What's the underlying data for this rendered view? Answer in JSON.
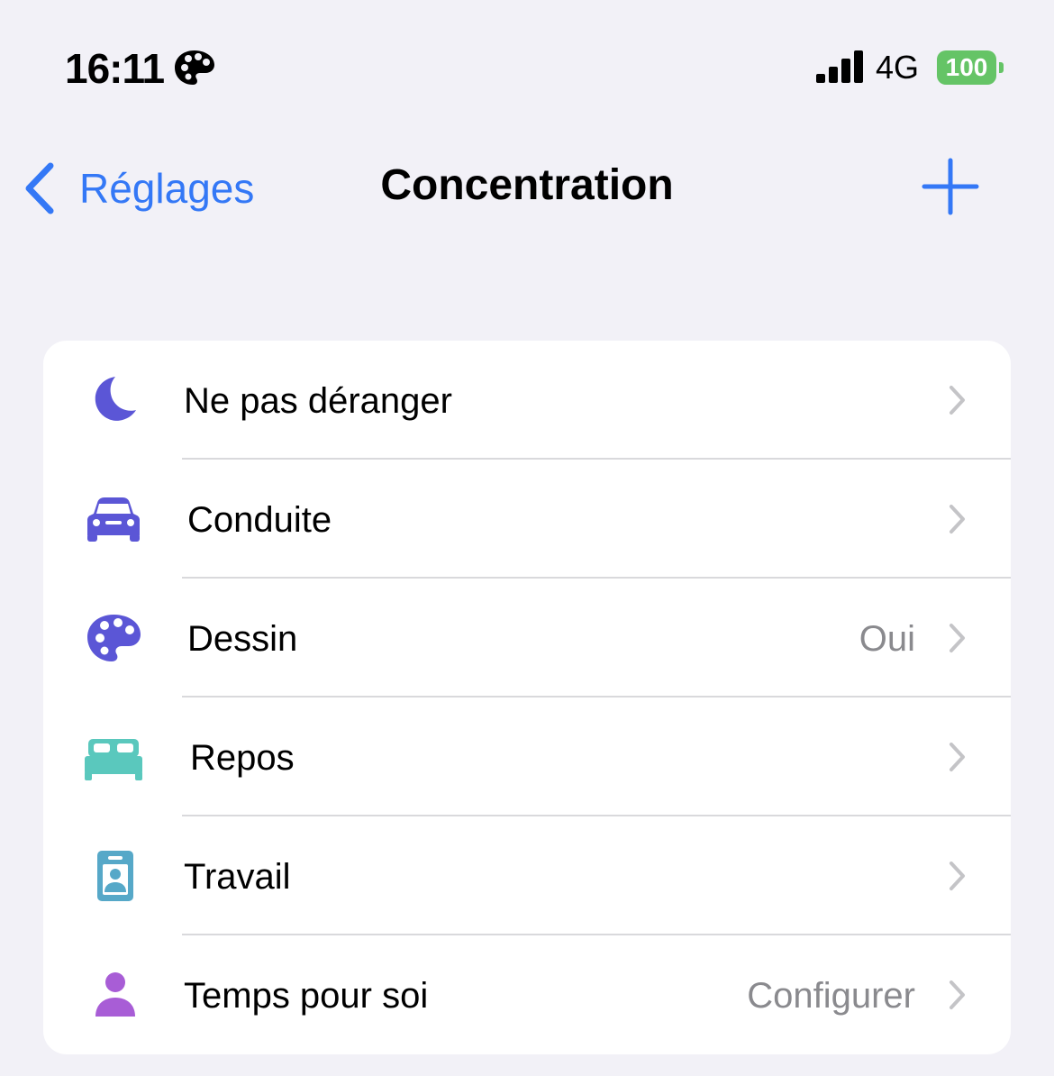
{
  "status_bar": {
    "time": "16:11",
    "focus_icon": "palette-icon",
    "network": "4G",
    "battery": "100",
    "battery_color": "#65c466"
  },
  "nav": {
    "back_label": "Réglages",
    "title": "Concentration",
    "add_icon": "plus-icon",
    "accent_color": "#3478f6"
  },
  "focus_modes": [
    {
      "label": "Ne pas déranger",
      "value": "",
      "icon": "moon-icon",
      "color": "#5b56d6"
    },
    {
      "label": "Conduite",
      "value": "",
      "icon": "car-icon",
      "color": "#5b56d6"
    },
    {
      "label": "Dessin",
      "value": "Oui",
      "icon": "palette-icon",
      "color": "#5b56d6"
    },
    {
      "label": "Repos",
      "value": "",
      "icon": "bed-icon",
      "color": "#5ac8bd"
    },
    {
      "label": "Travail",
      "value": "",
      "icon": "id-badge-icon",
      "color": "#56a8c8"
    },
    {
      "label": "Temps pour soi",
      "value": "Configurer",
      "icon": "person-icon",
      "color": "#a85dd6"
    }
  ]
}
